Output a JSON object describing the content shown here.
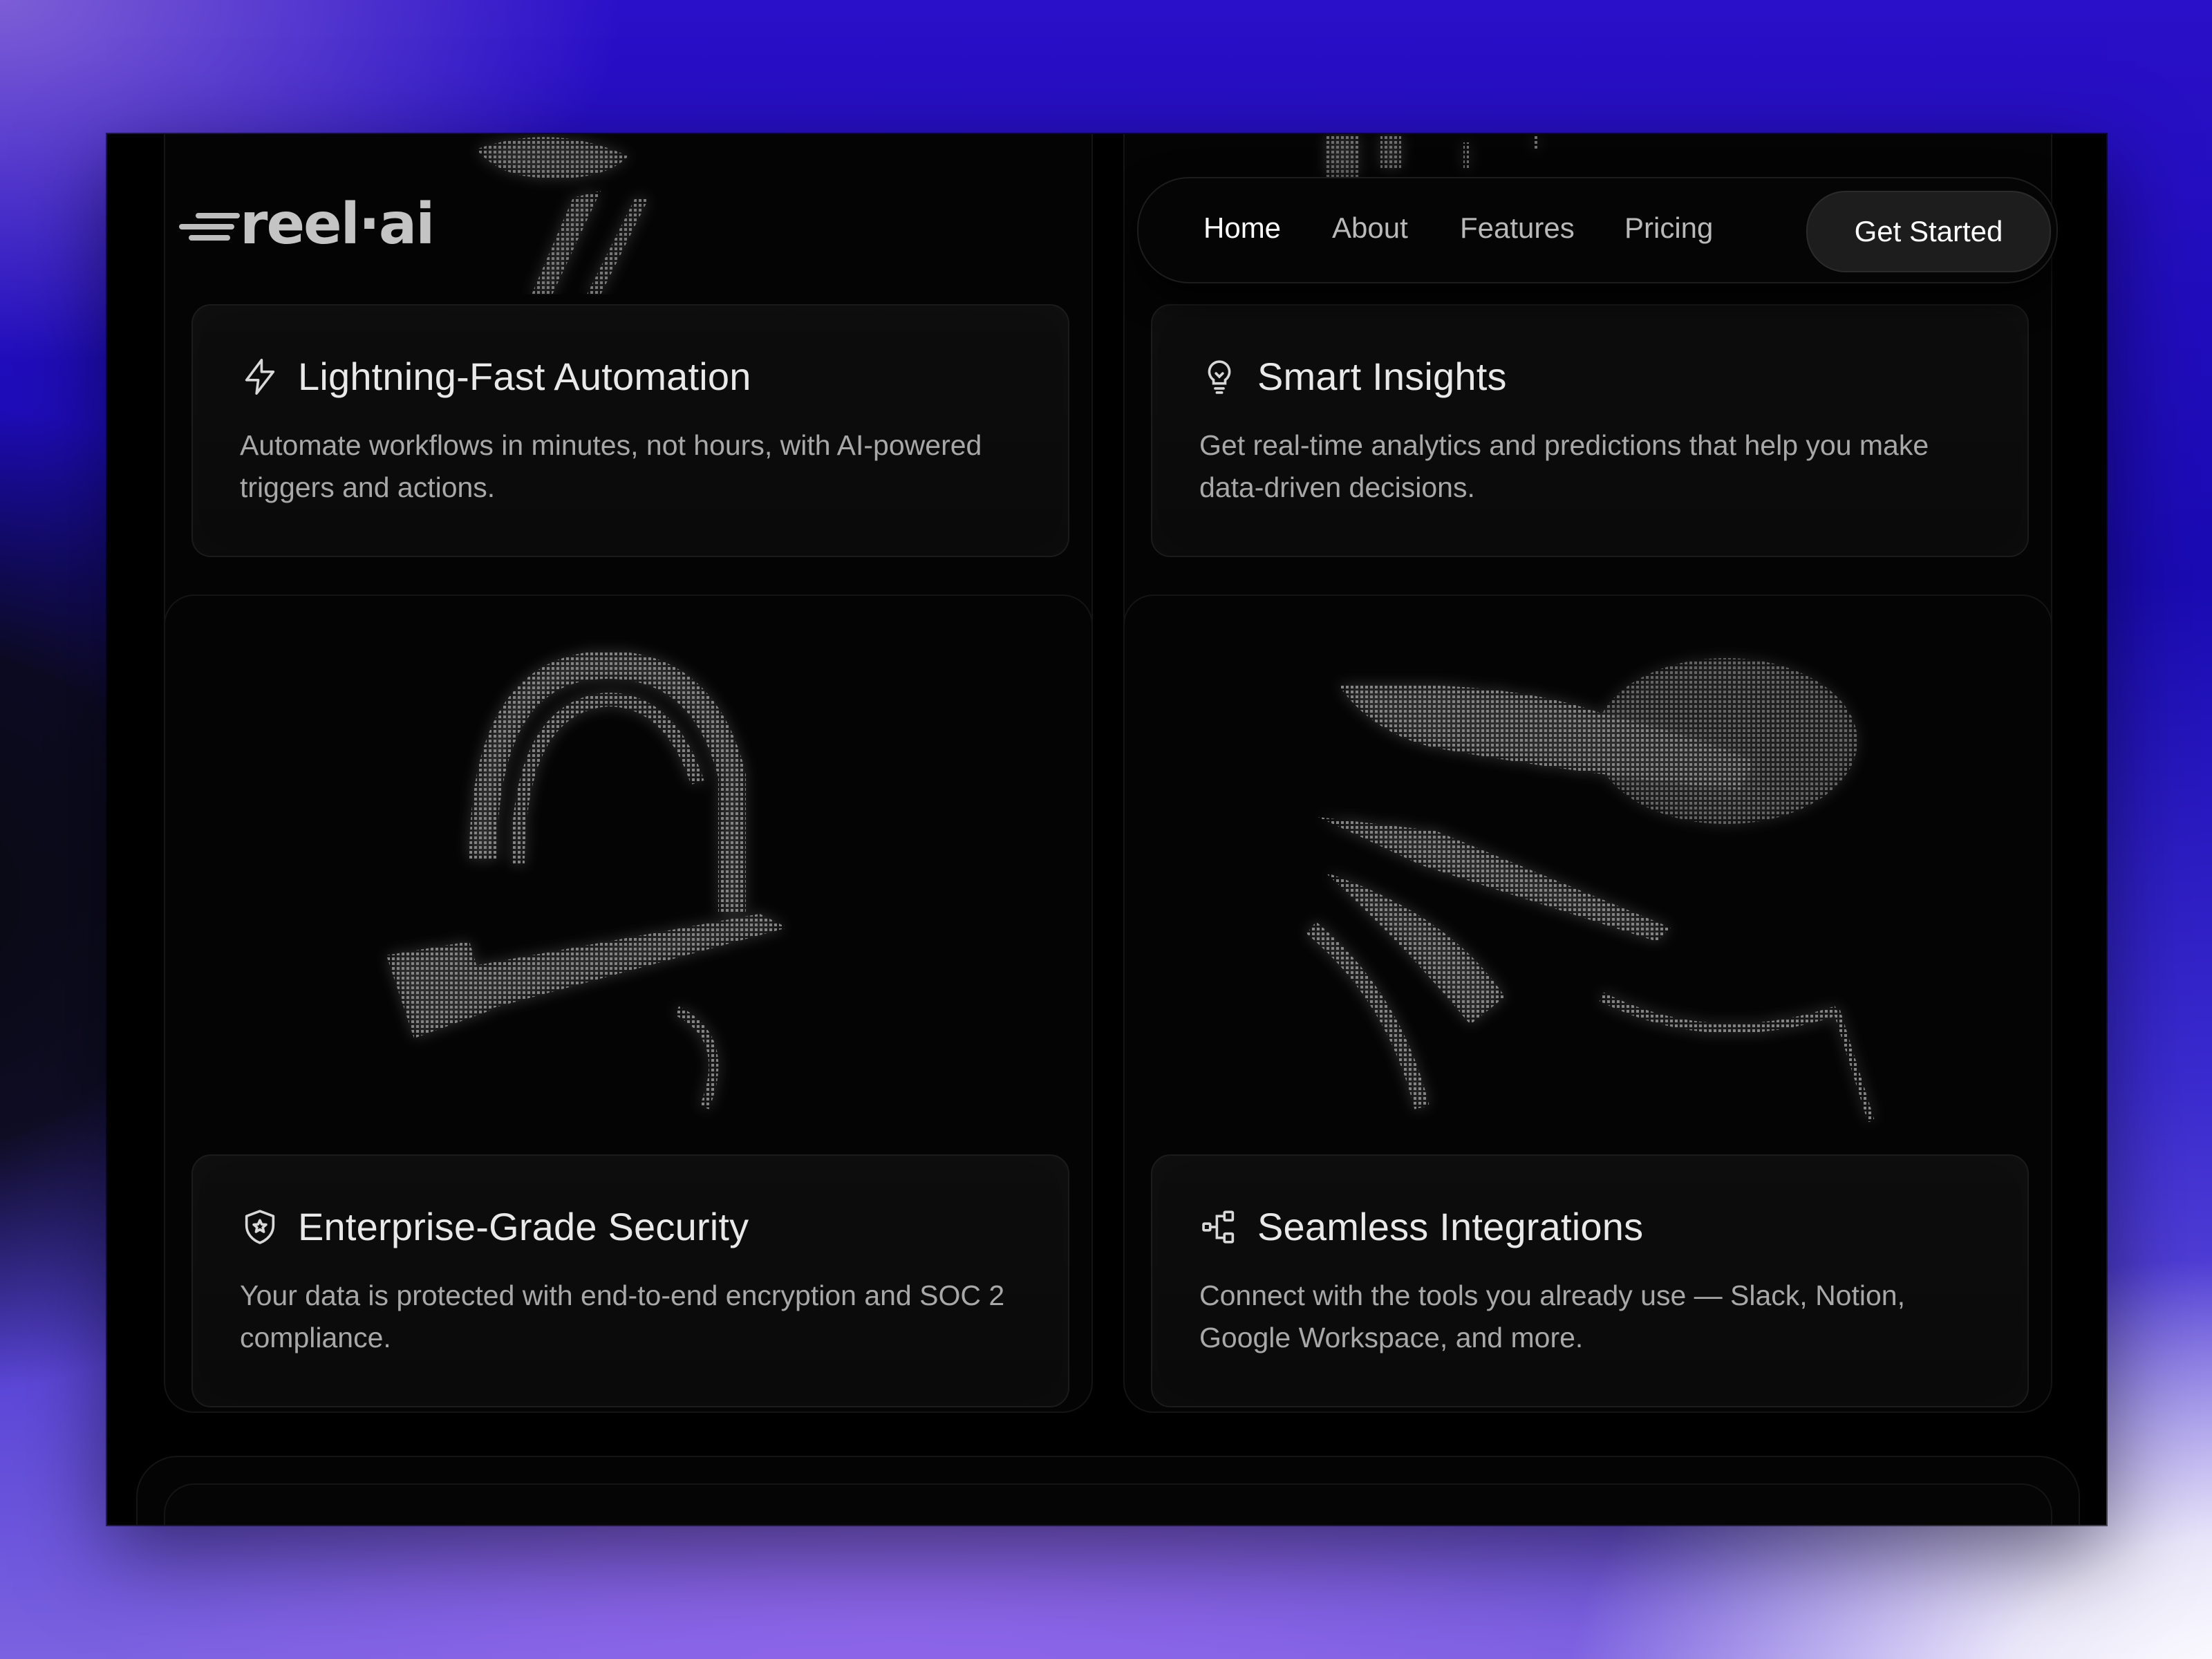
{
  "brand": {
    "name": "reel·ai",
    "logo_icon": "speed-lines-icon"
  },
  "nav": {
    "links": [
      {
        "label": "Home",
        "active": true
      },
      {
        "label": "About",
        "active": false
      },
      {
        "label": "Features",
        "active": false
      },
      {
        "label": "Pricing",
        "active": false
      }
    ],
    "cta_label": "Get Started"
  },
  "features": [
    {
      "icon": "lightning-icon",
      "title": "Lightning-Fast Automation",
      "description": "Automate workflows in minutes, not hours, with AI-powered triggers and actions."
    },
    {
      "icon": "lightbulb-icon",
      "title": "Smart Insights",
      "description": "Get real-time analytics and predictions that help you make data-driven decisions."
    },
    {
      "icon": "shield-star-icon",
      "title": "Enterprise-Grade Security",
      "description": "Your data is protected with end-to-end encryption and SOC 2 compliance."
    },
    {
      "icon": "integrations-icon",
      "title": "Seamless Integrations",
      "description": "Connect with the tools you already use — Slack, Notion, Google Workspace, and more."
    }
  ],
  "colors": {
    "page_bg": "#000000",
    "text": "#e9e9e9",
    "muted": "#a8a8a8",
    "cta_bg": "#1d1d1d",
    "frame_gradient_top": "#1a0bb3",
    "frame_gradient_bottom": "#8f66ea"
  }
}
